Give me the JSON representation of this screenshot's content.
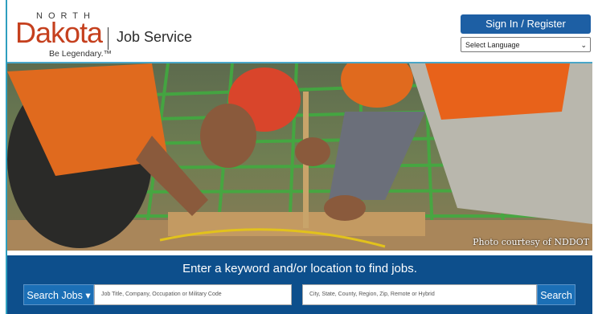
{
  "brand": {
    "north": "NORTH",
    "dakota": "Dakota",
    "job_service": "Job Service",
    "tagline": "Be Legendary.™"
  },
  "header": {
    "signin_label": "Sign In / Register",
    "language_select": {
      "selected": "Select Language",
      "icon": "chevron-down-icon"
    }
  },
  "hero": {
    "credit": "Photo courtesy of NDDOT"
  },
  "search": {
    "prompt": "Enter a keyword and/or location to find jobs.",
    "type_button": "Search Jobs",
    "type_button_icon": "caret-down-icon",
    "keyword_placeholder": "Job Title, Company, Occupation or Military Code",
    "location_placeholder": "City, State, County, Region, Zip, Remote or Hybrid",
    "submit_label": "Search"
  },
  "colors": {
    "brand_orange": "#c5401e",
    "primary_blue": "#1d5fa4",
    "search_band": "#0d4f8c",
    "accent_line": "#2f9fbf"
  }
}
